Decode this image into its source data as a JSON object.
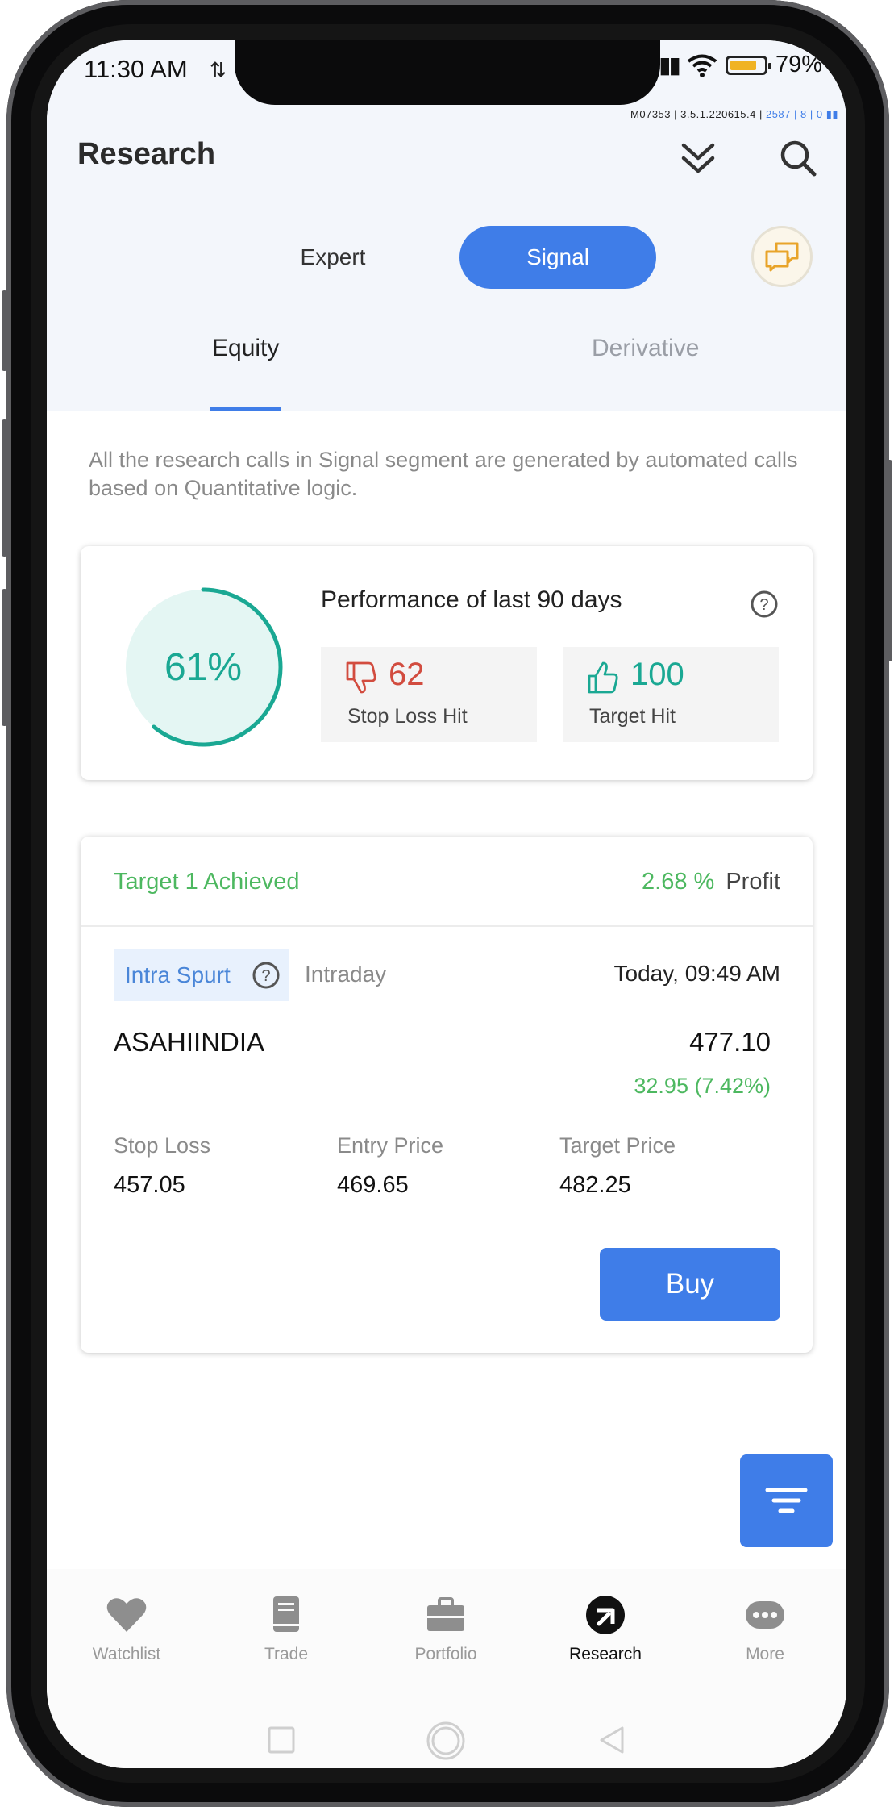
{
  "status_bar": {
    "time": "11:30 AM",
    "data_arrows": "⇅",
    "battery": "79%",
    "battery_fill": 0.79
  },
  "version": {
    "build": "M07353 | 3.5.1.220615.4 | ",
    "ids": "2587 | 8 | 0"
  },
  "header": {
    "title": "Research"
  },
  "segment": {
    "expert": "Expert",
    "signal": "Signal"
  },
  "tabs": {
    "equity": "Equity",
    "derivative": "Derivative"
  },
  "info_text": "All the research calls in Signal segment are generated by automated calls based on Quantitative logic.",
  "performance": {
    "percent_label": "61%",
    "percent_value": 0.61,
    "title": "Performance of last 90 days",
    "stop_loss_count": "62",
    "stop_loss_label": "Stop Loss Hit",
    "target_count": "100",
    "target_label": "Target Hit"
  },
  "call": {
    "status": "Target 1 Achieved",
    "profit_pct": "2.68 %",
    "profit_label": "Profit",
    "tag": "Intra Spurt",
    "type": "Intraday",
    "time": "Today, 09:49 AM",
    "symbol": "ASAHIINDIA",
    "price": "477.10",
    "change": "32.95 (7.42%)",
    "stop_loss_label": "Stop Loss",
    "stop_loss_value": "457.05",
    "entry_label": "Entry Price",
    "entry_value": "469.65",
    "target_label": "Target Price",
    "target_value": "482.25",
    "buy_label": "Buy"
  },
  "bottom_nav": [
    {
      "label": "Watchlist",
      "icon": "heart-icon"
    },
    {
      "label": "Trade",
      "icon": "book-icon"
    },
    {
      "label": "Portfolio",
      "icon": "briefcase-icon"
    },
    {
      "label": "Research",
      "icon": "research-icon"
    },
    {
      "label": "More",
      "icon": "more-icon"
    }
  ],
  "colors": {
    "accent": "#3f7de8",
    "positive": "#4db860",
    "negative": "#d24c3f",
    "teal": "#1aa893"
  }
}
